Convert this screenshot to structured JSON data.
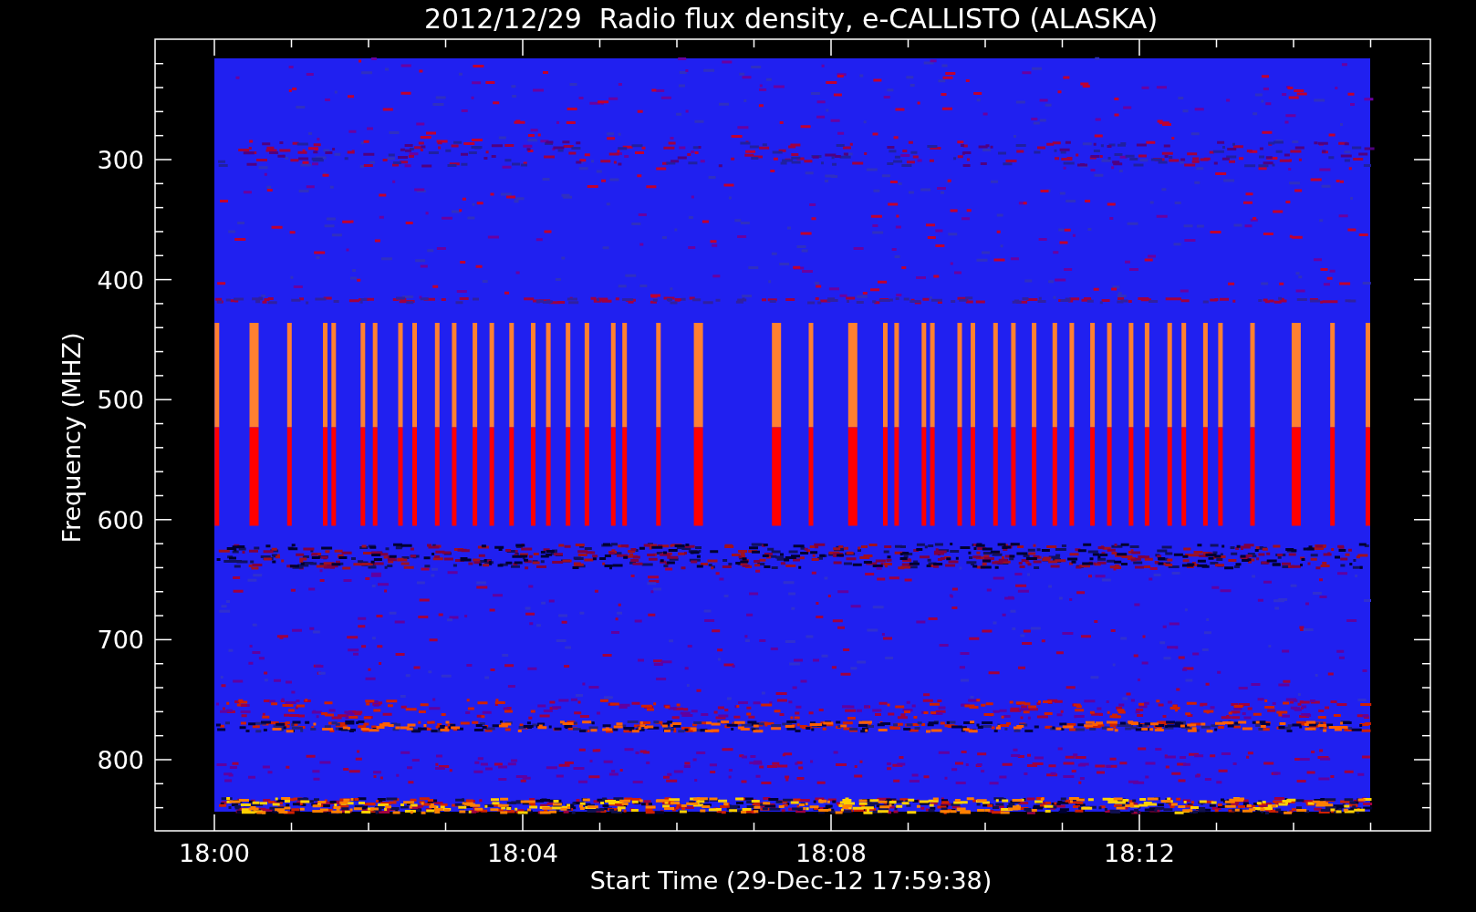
{
  "plot": {
    "title": "2012/12/29  Radio flux density, e-CALLISTO (ALASKA)",
    "x_axis": {
      "label": "Start Time (29-Dec-12 17:59:38)",
      "ticks": [
        "18:00",
        "18:04",
        "18:08",
        "18:12"
      ]
    },
    "y_axis": {
      "label": "Frequency (MHZ)",
      "ticks": [
        "300",
        "400",
        "500",
        "600",
        "700",
        "800"
      ]
    }
  }
}
